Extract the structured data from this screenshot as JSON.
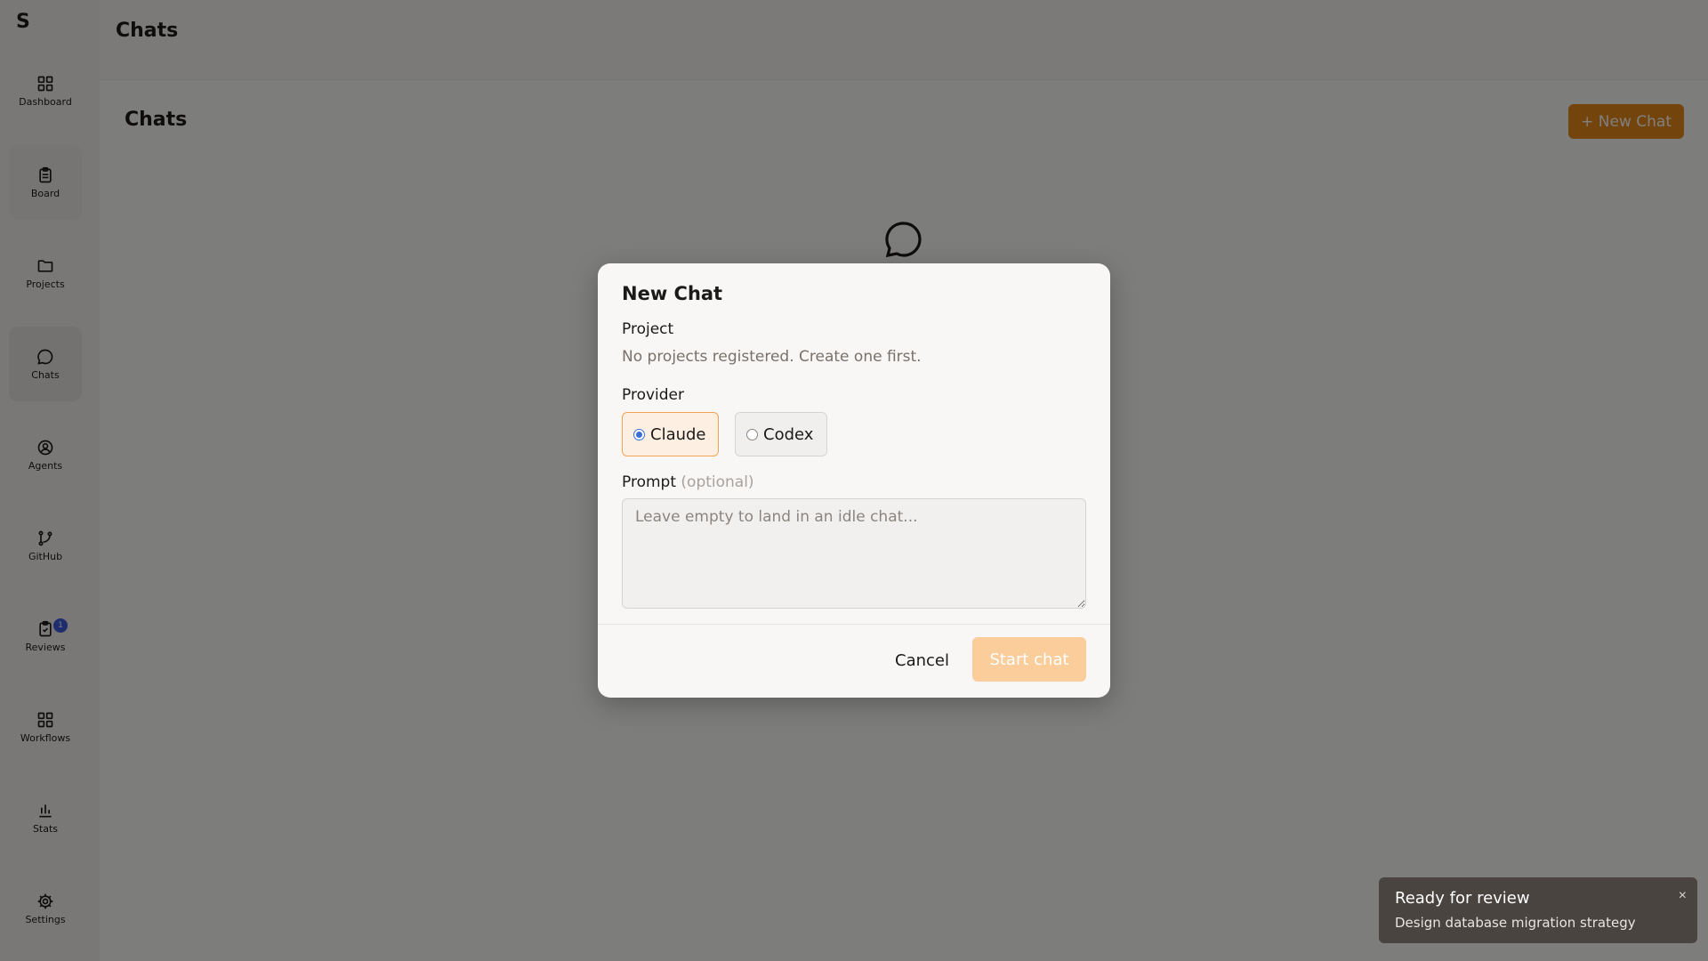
{
  "sidebar": {
    "logo": "S",
    "items": [
      {
        "label": "Dashboard",
        "icon": "grid-icon"
      },
      {
        "label": "Board",
        "icon": "clipboard-icon"
      },
      {
        "label": "Projects",
        "icon": "folder-icon"
      },
      {
        "label": "Chats",
        "icon": "chat-bubble-icon"
      },
      {
        "label": "Agents",
        "icon": "user-circle-icon"
      },
      {
        "label": "GitHub",
        "icon": "git-branch-icon"
      },
      {
        "label": "Reviews",
        "icon": "clipboard-check-icon",
        "badge": "1"
      },
      {
        "label": "Workflows",
        "icon": "grid-icon"
      },
      {
        "label": "Stats",
        "icon": "bar-chart-icon"
      },
      {
        "label": "Settings",
        "icon": "gear-icon"
      }
    ],
    "active": "Chats"
  },
  "header": {
    "title": "Chats"
  },
  "main": {
    "title": "Chats",
    "new_chat_label": "+ New Chat",
    "empty_icon": "chat-bubble-icon"
  },
  "modal": {
    "title": "New Chat",
    "project_label": "Project",
    "project_hint": "No projects registered. Create one first.",
    "provider_label": "Provider",
    "providers": [
      {
        "label": "Claude",
        "selected": true
      },
      {
        "label": "Codex",
        "selected": false
      }
    ],
    "prompt_label": "Prompt",
    "prompt_optional": "(optional)",
    "prompt_placeholder": "Leave empty to land in an idle chat...",
    "prompt_value": "",
    "cancel_label": "Cancel",
    "start_label": "Start chat"
  },
  "toast": {
    "title": "Ready for review",
    "body": "Design database migration strategy",
    "close": "×"
  },
  "colors": {
    "accent": "#e8891a",
    "accent_disabled": "#fbcd9a",
    "selected_border": "#f0a451",
    "toast_bg": "#4a4440"
  }
}
